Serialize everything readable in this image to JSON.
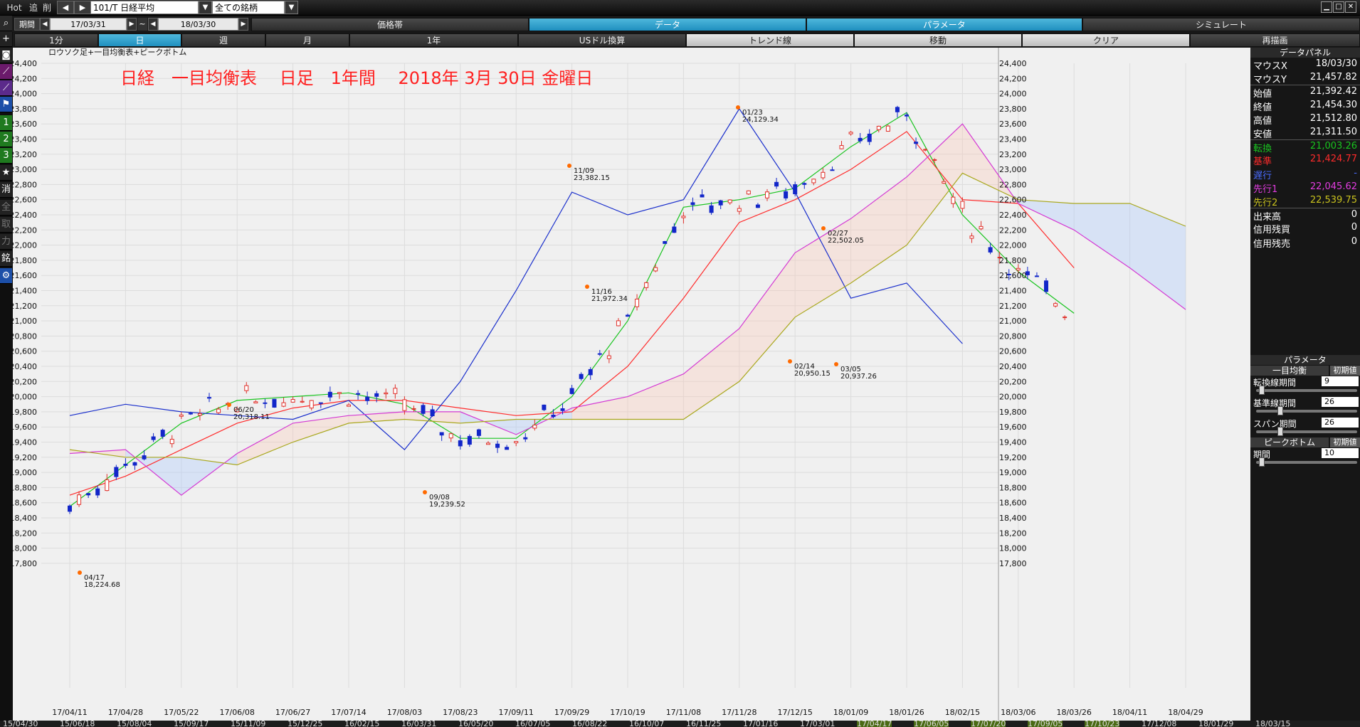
{
  "toolbar": {
    "hot": "Hot",
    "tsui": "追",
    "sakujo": "削",
    "symbol": "101/T 日経平均",
    "filter": "全ての銘柄",
    "window_min": "▁",
    "window_max": "□",
    "window_close": "✕"
  },
  "period_bar": {
    "label": "期間",
    "start": "17/03/31",
    "tilde": "~",
    "end": "18/03/30",
    "tabs": [
      "価格帯",
      "データ",
      "パラメータ",
      "シミュレート"
    ]
  },
  "interval_bar": {
    "tabs": [
      "1分",
      "日",
      "週",
      "月",
      "1年",
      "USドル換算",
      "トレンド線",
      "移動",
      "クリア",
      "再描画"
    ]
  },
  "left_toolbar": [
    "search-icon",
    "plus-icon",
    "camera-icon",
    "line-tool-icon",
    "trend-tool-icon",
    "flag-icon",
    "1",
    "2",
    "3",
    "★",
    "消",
    "全",
    "取",
    "力",
    "銘",
    "⚙"
  ],
  "chart": {
    "subtitle": "ロウソク足+一目均衡表+ピークボトム",
    "title": "日経　一目均衡表　 日足　1年間　 2018年 3月 30日 金曜日",
    "y_ticks": [
      "24,400",
      "24,200",
      "24,000",
      "23,800",
      "23,600",
      "23,400",
      "23,200",
      "23,000",
      "22,800",
      "22,600",
      "22,400",
      "22,200",
      "22,000",
      "21,800",
      "21,600",
      "21,400",
      "21,200",
      "21,000",
      "20,800",
      "20,600",
      "20,400",
      "20,200",
      "20,000",
      "19,800",
      "19,600",
      "19,400",
      "19,200",
      "19,000",
      "18,800",
      "18,600",
      "18,400",
      "18,200",
      "18,000",
      "17,800"
    ],
    "x_ticks": [
      "17/04/11",
      "17/04/28",
      "17/05/22",
      "17/06/08",
      "17/06/27",
      "17/07/14",
      "17/08/03",
      "17/08/23",
      "17/09/11",
      "17/09/29",
      "17/10/19",
      "17/11/08",
      "17/11/28",
      "17/12/15",
      "18/01/09",
      "18/01/26",
      "18/02/15",
      "18/03/06",
      "18/03/26",
      "18/04/11",
      "18/04/29"
    ],
    "annotations": [
      {
        "date": "04/17",
        "value": "18,224.68"
      },
      {
        "date": "06/20",
        "value": "20,318.11"
      },
      {
        "date": "09/08",
        "value": "19,239.52"
      },
      {
        "date": "11/09",
        "value": "23,382.15"
      },
      {
        "date": "11/16",
        "value": "21,972.34"
      },
      {
        "date": "01/23",
        "value": "24,129.34"
      },
      {
        "date": "02/14",
        "value": "20,950.15"
      },
      {
        "date": "02/27",
        "value": "22,502.05"
      },
      {
        "date": "03/05",
        "value": "20,937.26"
      }
    ]
  },
  "chart_data": {
    "type": "line",
    "title": "日経　一目均衡表　 日足　1年間　 2018年 3月 30日 金曜日",
    "ylim": [
      17800,
      24400
    ],
    "x": [
      "17/04/11",
      "17/04/28",
      "17/05/22",
      "17/06/08",
      "17/06/27",
      "17/07/14",
      "17/08/03",
      "17/08/23",
      "17/09/11",
      "17/09/29",
      "17/10/19",
      "17/11/08",
      "17/11/28",
      "17/12/15",
      "18/01/09",
      "18/01/26",
      "18/02/15",
      "18/03/06",
      "18/03/26",
      "18/04/11",
      "18/04/29"
    ],
    "series": [
      {
        "name": "転換",
        "values": [
          18550,
          19100,
          19650,
          19950,
          20000,
          20050,
          19900,
          19450,
          19450,
          20000,
          21000,
          22500,
          22600,
          22750,
          23300,
          23750,
          22400,
          21650,
          21100,
          null,
          null
        ]
      },
      {
        "name": "基準",
        "values": [
          18700,
          18950,
          19300,
          19650,
          19850,
          19950,
          19950,
          19850,
          19750,
          19800,
          20400,
          21300,
          22300,
          22600,
          23000,
          23500,
          22600,
          22550,
          21700,
          null,
          null
        ]
      },
      {
        "name": "遅行",
        "values": [
          19750,
          19900,
          19800,
          19750,
          19700,
          19950,
          19300,
          20200,
          21400,
          22700,
          22400,
          22600,
          23800,
          22700,
          21300,
          21500,
          20700,
          null,
          null,
          null,
          null
        ]
      },
      {
        "name": "先行1",
        "values": [
          19250,
          19300,
          18700,
          19250,
          19650,
          19750,
          19800,
          19800,
          19500,
          19850,
          20000,
          20300,
          20900,
          21900,
          22350,
          22900,
          23600,
          22550,
          22200,
          21700,
          21150
        ]
      },
      {
        "name": "先行2",
        "values": [
          19300,
          19200,
          19200,
          19100,
          19400,
          19650,
          19700,
          19650,
          19700,
          19700,
          19700,
          19700,
          20200,
          21050,
          21500,
          22000,
          22950,
          22600,
          22550,
          22550,
          22250
        ]
      }
    ]
  },
  "data_panel": {
    "header": "データパネル",
    "rows": [
      {
        "label": "マウスX",
        "value": "18/03/30",
        "color": "#ffffff"
      },
      {
        "label": "マウスY",
        "value": "21,457.82",
        "color": "#ffffff"
      },
      {
        "label": "始値",
        "value": "21,392.42",
        "color": "#ffffff"
      },
      {
        "label": "終値",
        "value": "21,454.30",
        "color": "#ffffff"
      },
      {
        "label": "高値",
        "value": "21,512.80",
        "color": "#ffffff"
      },
      {
        "label": "安値",
        "value": "21,311.50",
        "color": "#ffffff"
      },
      {
        "label": "転換",
        "value": "21,003.26",
        "color": "#19c41f"
      },
      {
        "label": "基準",
        "value": "21,424.77",
        "color": "#ff2b2b"
      },
      {
        "label": "遅行",
        "value": "-",
        "color": "#4a6cff"
      },
      {
        "label": "先行1",
        "value": "22,045.62",
        "color": "#e23ce0"
      },
      {
        "label": "先行2",
        "value": "22,539.75",
        "color": "#c9c21e"
      },
      {
        "label": "出来高",
        "value": "0",
        "color": "#ffffff"
      },
      {
        "label": "信用残買",
        "value": "0",
        "color": "#ffffff"
      },
      {
        "label": "信用残売",
        "value": "0",
        "color": "#ffffff"
      }
    ]
  },
  "params": {
    "header": "パラメータ",
    "ichimoku_label": "一目均衡",
    "reset": "初期値",
    "items": [
      {
        "label": "転換線期間",
        "value": "9"
      },
      {
        "label": "基準線期間",
        "value": "26"
      },
      {
        "label": "スパン期間",
        "value": "26"
      }
    ],
    "peak_label": "ピークボトム",
    "peak_reset": "初期値",
    "peak_item": {
      "label": "期間",
      "value": "10"
    }
  },
  "bottom_axis": [
    "15/04/30",
    "15/06/18",
    "15/08/04",
    "15/09/17",
    "15/11/09",
    "15/12/25",
    "16/02/15",
    "16/03/31",
    "16/05/20",
    "16/07/05",
    "16/08/22",
    "16/10/07",
    "16/11/25",
    "17/01/16",
    "17/03/01",
    "17/04/17",
    "17/06/05",
    "17/07/20",
    "17/09/05",
    "17/10/23",
    "17/12/08",
    "18/01/29",
    "18/03/15"
  ],
  "colors": {
    "tenkan": "#19c41f",
    "kijun": "#ff2b2b",
    "chikou": "#1a2fcc",
    "senkou1": "#d43ad4",
    "senkou2": "#a9a81e",
    "up": "#e0302a",
    "down": "#1226c9",
    "title": "#ff2020"
  }
}
